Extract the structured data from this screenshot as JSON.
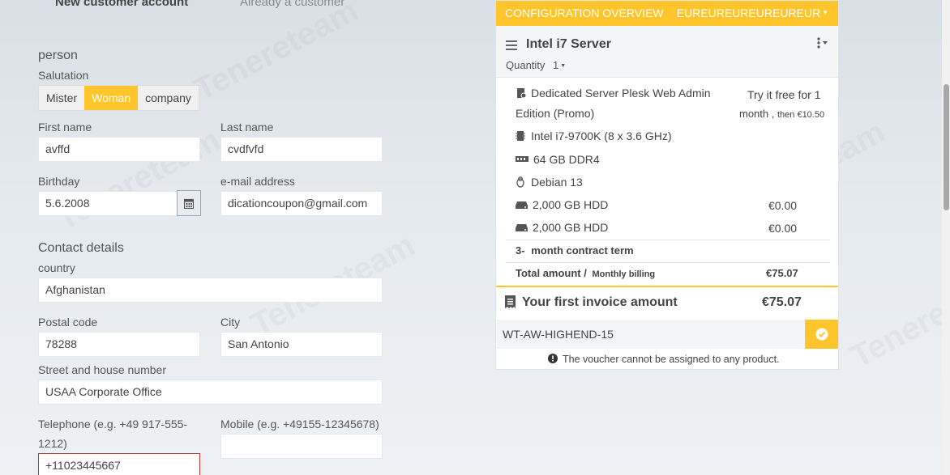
{
  "tabs": {
    "new_customer": "New customer account",
    "existing_customer": "Already a customer"
  },
  "person": {
    "section_title": "person",
    "salutation_label": "Salutation",
    "salutation_options": [
      "Mister",
      "Woman",
      "company"
    ],
    "salutation_selected": "Woman",
    "first_name_label": "First name",
    "first_name_value": "avffd",
    "last_name_label": "Last name",
    "last_name_value": "cvdfvfd",
    "birthday_label": "Birthday",
    "birthday_value": "5.6.2008",
    "email_label": "e-mail address",
    "email_value": "dicationcoupon@gmail.com"
  },
  "contact": {
    "section_title": "Contact details",
    "country_label": "country",
    "country_value": "Afghanistan",
    "postal_label": "Postal code",
    "postal_value": "78288",
    "city_label": "City",
    "city_value": "San Antonio",
    "street_label": "Street and house number",
    "street_value": "USAA Corporate Office",
    "telephone_label": "Telephone (e.g. +49 917-555-1212)",
    "telephone_value": "+11023445667",
    "mobile_label": "Mobile (e.g. +49155-12345678)",
    "mobile_value": ""
  },
  "config": {
    "header_title": "CONFIGURATION OVERVIEW",
    "currency": "EUREUREUREUREUREUR",
    "product_name": "Intel i7 Server",
    "quantity_label": "Quantity",
    "quantity_value": "1",
    "items": [
      {
        "icon": "plesk-icon",
        "text_line1": "Dedicated Server Plesk Web Admin",
        "text_line2": "Edition (Promo)",
        "price_line1": "Try it free for 1",
        "price_line2_main": "month ,",
        "price_line2_small": "then €10.50"
      },
      {
        "icon": "cpu-icon",
        "text": "Intel i7-9700K (8 x 3.6 GHz)",
        "price": ""
      },
      {
        "icon": "ram-icon",
        "text": "64 GB DDR4",
        "price": ""
      },
      {
        "icon": "linux-icon",
        "text": "Debian 13",
        "price": ""
      },
      {
        "icon": "hdd-icon",
        "text": "2,000 GB HDD",
        "price": "€0.00"
      },
      {
        "icon": "hdd-icon",
        "text": "2,000 GB HDD",
        "price": "€0.00"
      }
    ],
    "contract_term_num": "3-",
    "contract_term_text": "month  contract term",
    "total_label": "Total amount /",
    "total_sub": "Monthly billing",
    "total_value": "€75.07",
    "invoice_label": "Your first invoice amount",
    "invoice_value": "€75.07",
    "voucher_code": "WT-AW-HIGHEND-15",
    "voucher_message": "The voucher cannot be assigned to any product."
  },
  "colors": {
    "accent": "#ffc52a",
    "error": "#c0392b"
  }
}
